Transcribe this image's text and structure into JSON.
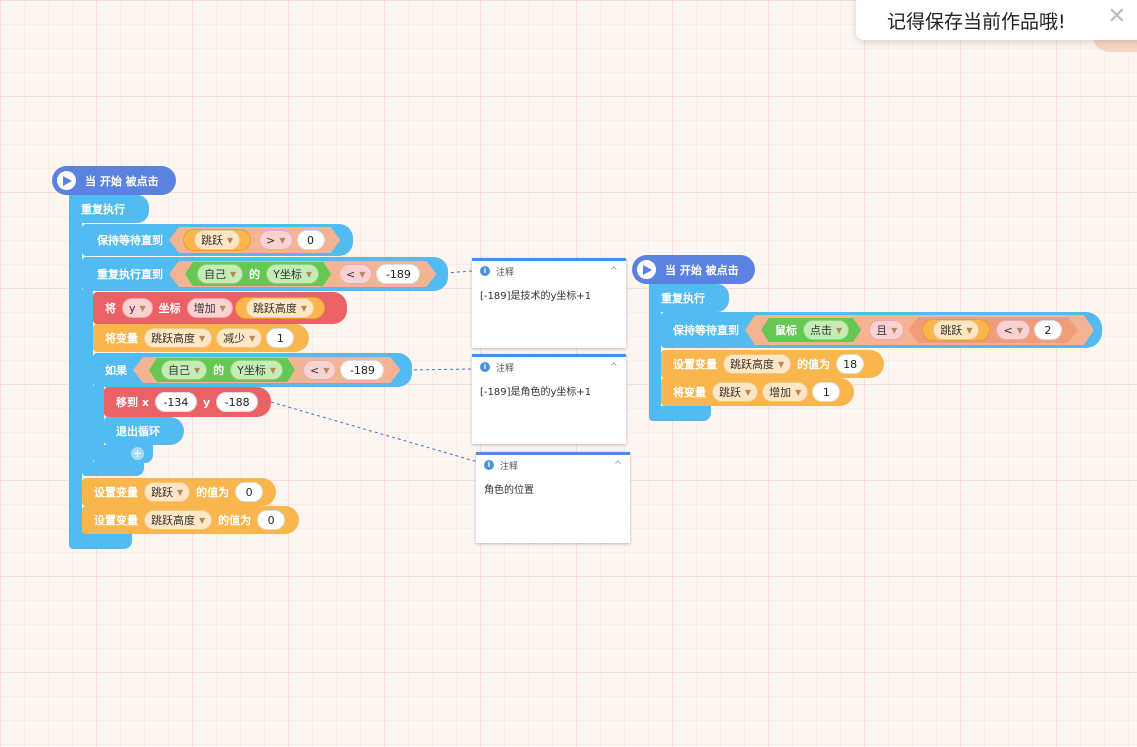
{
  "toast": {
    "message": "记得保存当前作品哦!"
  },
  "script1": {
    "hat": "当 开始 被点击",
    "forever": "重复执行",
    "wait_until": {
      "label": "保持等待直到",
      "var": "跳跃",
      "op": ">",
      "val": "0"
    },
    "repeat_until": {
      "label": "重复执行直到",
      "who": "自己",
      "of": "的",
      "prop": "Y坐标",
      "op": "<",
      "val": "-189"
    },
    "change_coord": {
      "label": "将",
      "axis": "y",
      "coord": "坐标",
      "mode": "增加",
      "var": "跳跃高度"
    },
    "change_var": {
      "label": "将变量",
      "var": "跳跃高度",
      "mode": "减少",
      "val": "1"
    },
    "if_block": {
      "label": "如果",
      "who": "自己",
      "of": "的",
      "prop": "Y坐标",
      "op": "<",
      "val": "-189"
    },
    "move_to": {
      "label": "移到 x",
      "x": "-134",
      "ylabel": "y",
      "y": "-188"
    },
    "break": "退出循环",
    "set1": {
      "label": "设置变量",
      "var": "跳跃",
      "mid": "的值为",
      "val": "0"
    },
    "set2": {
      "label": "设置变量",
      "var": "跳跃高度",
      "mid": "的值为",
      "val": "0"
    }
  },
  "script2": {
    "hat": "当 开始 被点击",
    "forever": "重复执行",
    "wait_until": {
      "label": "保持等待直到",
      "mouse": "鼠标",
      "event": "点击",
      "and": "且",
      "var": "跳跃",
      "op": "<",
      "val": "2"
    },
    "set": {
      "label": "设置变量",
      "var": "跳跃高度",
      "mid": "的值为",
      "val": "18"
    },
    "change": {
      "label": "将变量",
      "var": "跳跃",
      "mode": "增加",
      "val": "1"
    }
  },
  "notes": [
    {
      "title": "注释",
      "body": "[-189]是技术的y坐标+1"
    },
    {
      "title": "注释",
      "body": "[-189]是角色的y坐标+1"
    },
    {
      "title": "注释",
      "body": "角色的位置"
    }
  ],
  "colors": {
    "hat": "#5b82e0",
    "control": "#52bcf2",
    "motion": "#ec6166",
    "variable": "#f9b64d",
    "sensing": "#66c752",
    "note_accent": "#4a90e2"
  }
}
